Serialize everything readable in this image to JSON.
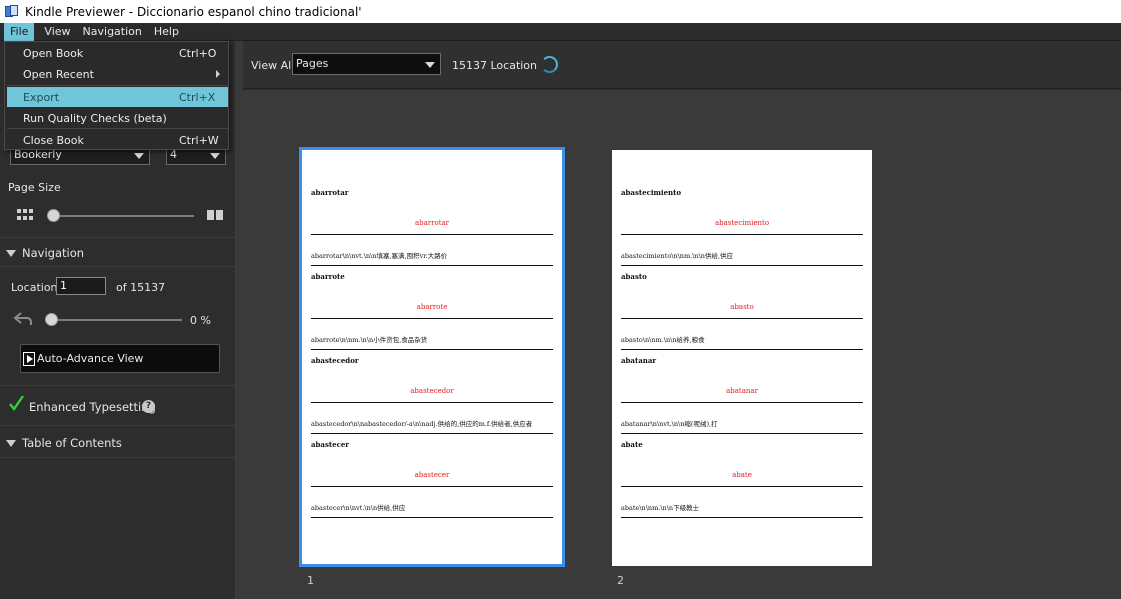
{
  "window": {
    "title": "Kindle Previewer - Diccionario espanol chino tradicional'"
  },
  "menubar": {
    "file": "File",
    "view": "View",
    "navigation": "Navigation",
    "help": "Help"
  },
  "file_menu": {
    "open_book": "Open Book",
    "open_book_shortcut": "Ctrl+O",
    "open_recent": "Open Recent",
    "export": "Export",
    "export_shortcut": "Ctrl+X",
    "run_quality": "Run Quality Checks (beta)",
    "close_book": "Close Book",
    "close_book_shortcut": "Ctrl+W"
  },
  "left": {
    "font_value": "Bookerly",
    "font_size_value": "4",
    "page_size_label": "Page Size",
    "navigation_label": "Navigation",
    "location_label": "Location",
    "location_value": "1",
    "location_of": "of 15137",
    "progress_text": "0 %",
    "progress_fraction": 0,
    "auto_advance": "Auto-Advance View",
    "enhanced_typesetting": "Enhanced Typesetting",
    "help_glyph": "?",
    "toc_label": "Table of Contents"
  },
  "toolbar": {
    "view_all": "View All",
    "view_select": "Pages",
    "location_count": "15137 Location"
  },
  "pages": [
    {
      "number": "1",
      "entries": [
        {
          "word": "abarrotar",
          "red": "abarrotar",
          "def": "abarrotar\\n\\nvt.\\n\\n填塞,塞满,囤积vr.大路价"
        },
        {
          "word": "abarrote",
          "red": "abarrote",
          "def": "abarrote\\n\\nm.\\n\\n小件货包,食品杂货"
        },
        {
          "word": "abastecedor",
          "red": "abastecedor",
          "def": "abastecedor\\n\\nabastecedor/-a\\n\\nadj.供给的,供应的m.f.供给者,供应者"
        },
        {
          "word": "abastecer",
          "red": "abastecer",
          "def": "abastecer\\n\\nvt.\\n\\n供给,供应"
        }
      ]
    },
    {
      "number": "2",
      "entries": [
        {
          "word": "abastecimiento",
          "red": "abastecimiento",
          "def": "abastecimiento\\n\\nm.\\n\\n供给,供应"
        },
        {
          "word": "abasto",
          "red": "abasto",
          "def": "abasto\\n\\nm.\\n\\n给养,粮食"
        },
        {
          "word": "abatanar",
          "red": "abatanar",
          "def": "abatanar\\n\\nvt.\\n\\n缩(呢绒),打"
        },
        {
          "word": "abate",
          "red": "abate",
          "def": "abate\\n\\nm.\\n\\n下级教士"
        }
      ]
    }
  ]
}
